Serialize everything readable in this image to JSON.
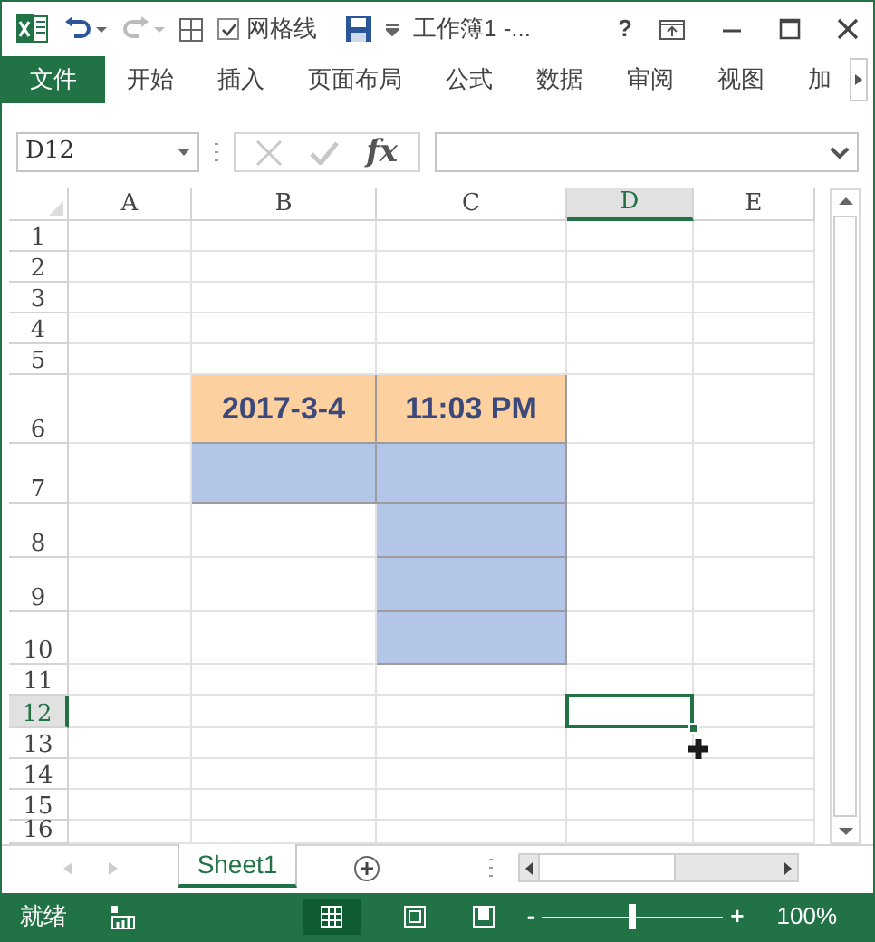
{
  "title_bar": {
    "gridlines_label": "网格线",
    "gridlines_checked": true,
    "title": "工作簿1 -...",
    "help": "?"
  },
  "ribbon_tabs": [
    {
      "label": "文件",
      "kind": "file"
    },
    {
      "label": "开始",
      "kind": "tab"
    },
    {
      "label": "插入",
      "kind": "tab"
    },
    {
      "label": "页面布局",
      "kind": "tab"
    },
    {
      "label": "公式",
      "kind": "tab"
    },
    {
      "label": "数据",
      "kind": "tab"
    },
    {
      "label": "审阅",
      "kind": "tab"
    },
    {
      "label": "视图",
      "kind": "tab"
    },
    {
      "label": "加",
      "kind": "tab"
    }
  ],
  "formula_bar": {
    "name_box": "D12",
    "fx": "fx"
  },
  "columns": [
    {
      "label": "A",
      "selected": false
    },
    {
      "label": "B",
      "selected": false
    },
    {
      "label": "C",
      "selected": false
    },
    {
      "label": "D",
      "selected": true
    },
    {
      "label": "E",
      "selected": false
    }
  ],
  "rows": [
    {
      "label": "1",
      "selected": false,
      "cells": [
        {
          "color": "#ffffff"
        },
        {
          "color": "#ffffff"
        },
        {
          "color": "#ffffff"
        },
        {
          "color": "#ffffff"
        },
        {
          "color": "#ffffff"
        }
      ]
    },
    {
      "label": "2",
      "selected": false,
      "cells": [
        {
          "color": "#ffffff"
        },
        {
          "color": "#ffffff"
        },
        {
          "color": "#ffffff"
        },
        {
          "color": "#ffffff"
        },
        {
          "color": "#ffffff"
        }
      ]
    },
    {
      "label": "3",
      "selected": false,
      "cells": [
        {
          "color": "#ffffff"
        },
        {
          "color": "#ffffff"
        },
        {
          "color": "#ffffff"
        },
        {
          "color": "#ffffff"
        },
        {
          "color": "#ffffff"
        }
      ]
    },
    {
      "label": "4",
      "selected": false,
      "cells": [
        {
          "color": "#ffffff"
        },
        {
          "color": "#ffffff"
        },
        {
          "color": "#ffffff"
        },
        {
          "color": "#ffffff"
        },
        {
          "color": "#ffffff"
        }
      ]
    },
    {
      "label": "5",
      "selected": false,
      "cells": [
        {
          "color": "#ffffff"
        },
        {
          "color": "#ffffff"
        },
        {
          "color": "#ffffff"
        },
        {
          "color": "#ffffff"
        },
        {
          "color": "#ffffff"
        }
      ]
    },
    {
      "label": "6",
      "selected": false,
      "cells": [
        {
          "color": "#ffffff"
        },
        {
          "text": "2017-3-4",
          "color": "#fcd09f"
        },
        {
          "text": "11:03 PM",
          "color": "#fcd09f"
        },
        {
          "color": "#ffffff"
        },
        {
          "color": "#ffffff"
        }
      ]
    },
    {
      "label": "7",
      "selected": false,
      "cells": [
        {
          "color": "#ffffff"
        },
        {
          "color": "#b4c6e7"
        },
        {
          "color": "#b4c6e7"
        },
        {
          "color": "#ffffff"
        },
        {
          "color": "#ffffff"
        }
      ]
    },
    {
      "label": "8",
      "selected": false,
      "cells": [
        {
          "color": "#ffffff"
        },
        {
          "color": "#ffffff"
        },
        {
          "color": "#b4c6e7"
        },
        {
          "color": "#ffffff"
        },
        {
          "color": "#ffffff"
        }
      ]
    },
    {
      "label": "9",
      "selected": false,
      "cells": [
        {
          "color": "#ffffff"
        },
        {
          "color": "#ffffff"
        },
        {
          "color": "#b4c6e7"
        },
        {
          "color": "#ffffff"
        },
        {
          "color": "#ffffff"
        }
      ]
    },
    {
      "label": "10",
      "selected": false,
      "cells": [
        {
          "color": "#ffffff"
        },
        {
          "color": "#ffffff"
        },
        {
          "color": "#b4c6e7"
        },
        {
          "color": "#ffffff"
        },
        {
          "color": "#ffffff"
        }
      ]
    },
    {
      "label": "11",
      "selected": false,
      "cells": [
        {
          "color": "#ffffff"
        },
        {
          "color": "#ffffff"
        },
        {
          "color": "#ffffff"
        },
        {
          "color": "#ffffff"
        },
        {
          "color": "#ffffff"
        }
      ]
    },
    {
      "label": "12",
      "selected": true,
      "cells": [
        {
          "color": "#ffffff"
        },
        {
          "color": "#ffffff"
        },
        {
          "color": "#ffffff"
        },
        {
          "color": "#ffffff"
        },
        {
          "color": "#ffffff"
        }
      ]
    },
    {
      "label": "13",
      "selected": false,
      "cells": [
        {
          "color": "#ffffff"
        },
        {
          "color": "#ffffff"
        },
        {
          "color": "#ffffff"
        },
        {
          "color": "#ffffff"
        },
        {
          "color": "#ffffff"
        }
      ]
    },
    {
      "label": "14",
      "selected": false,
      "cells": [
        {
          "color": "#ffffff"
        },
        {
          "color": "#ffffff"
        },
        {
          "color": "#ffffff"
        },
        {
          "color": "#ffffff"
        },
        {
          "color": "#ffffff"
        }
      ]
    },
    {
      "label": "15",
      "selected": false,
      "cells": [
        {
          "color": "#ffffff"
        },
        {
          "color": "#ffffff"
        },
        {
          "color": "#ffffff"
        },
        {
          "color": "#ffffff"
        },
        {
          "color": "#ffffff"
        }
      ]
    },
    {
      "label": "16",
      "selected": false,
      "cells": [
        {
          "color": "#ffffff"
        },
        {
          "color": "#ffffff"
        },
        {
          "color": "#ffffff"
        },
        {
          "color": "#ffffff"
        },
        {
          "color": "#ffffff"
        }
      ]
    }
  ],
  "sheet_tabs": [
    {
      "label": "Sheet1",
      "selected": true
    }
  ],
  "status_bar": {
    "status": "就绪",
    "zoom": {
      "level": 0.5,
      "minus": "-",
      "plus": "+",
      "reading": "100%"
    }
  }
}
